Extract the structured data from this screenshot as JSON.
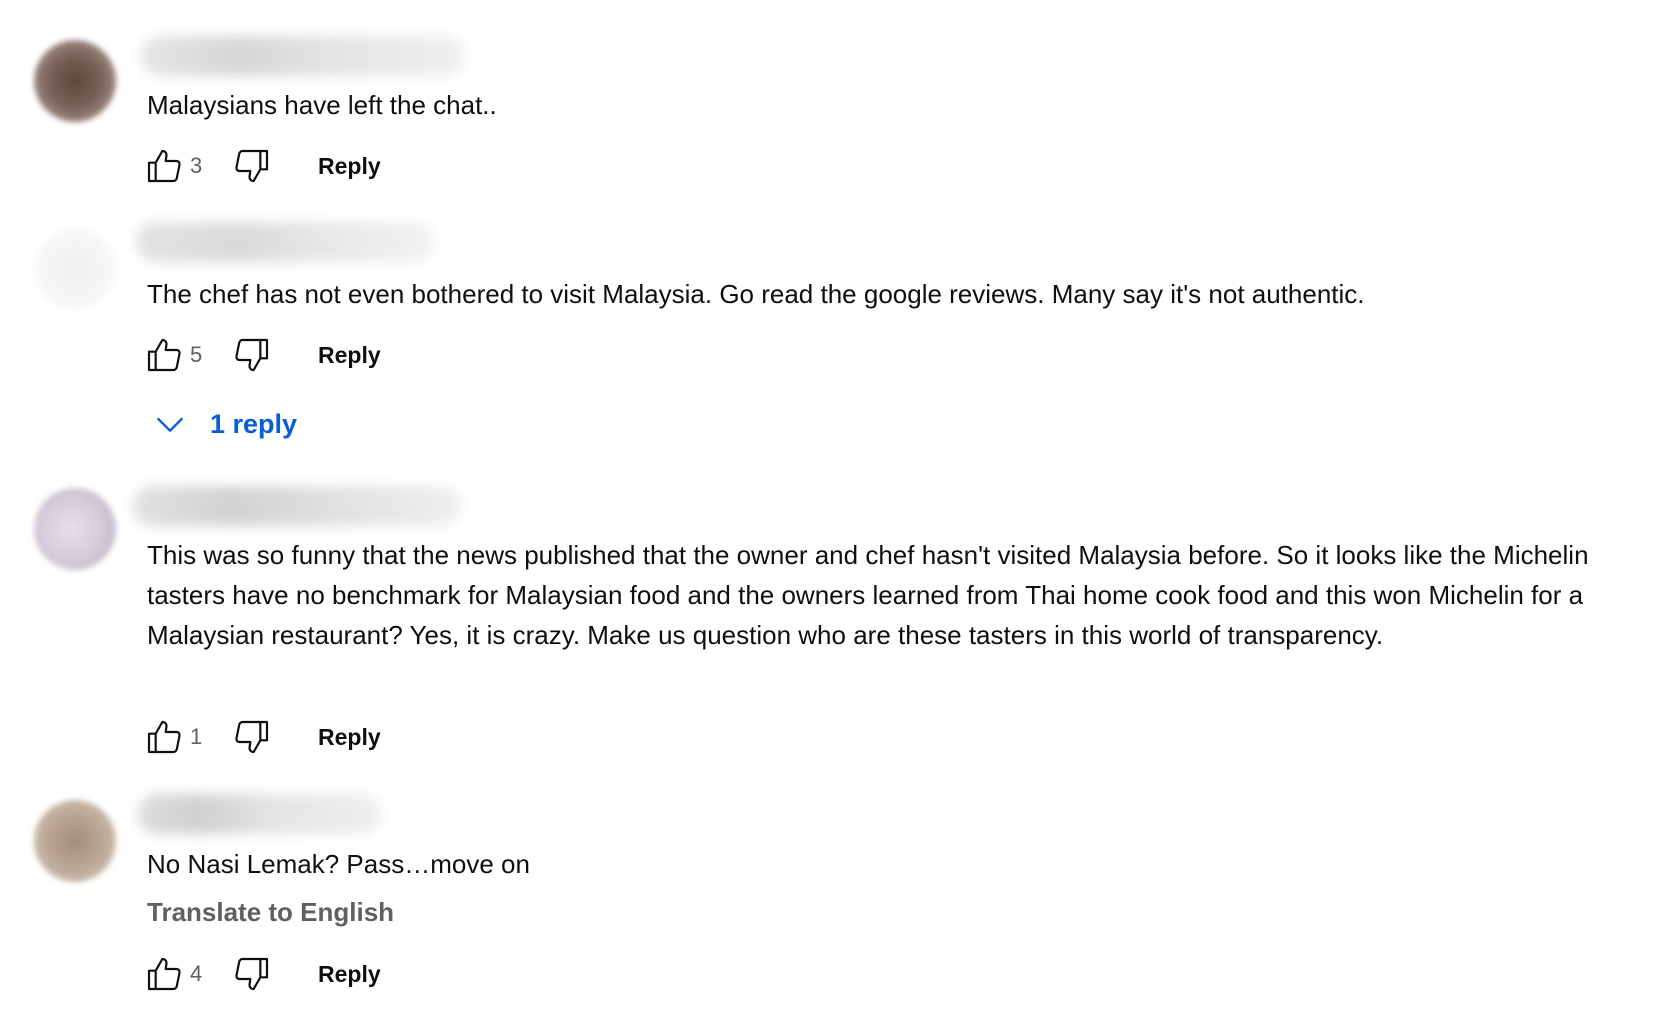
{
  "comments": [
    {
      "text": "Malaysians have left the chat..",
      "likes": "3",
      "reply_label": "Reply",
      "avatar_color": "#7a6259"
    },
    {
      "text": "The chef has not even bothered to visit Malaysia. Go read the google reviews. Many say it's not authentic.",
      "likes": "5",
      "reply_label": "Reply",
      "avatar_color": "#f4f4f4",
      "replies_label": "1 reply"
    },
    {
      "text": "This was so funny that the news published that the owner and chef hasn't visited Malaysia before. So it looks like the Michelin tasters have no benchmark for Malaysian food and the owners learned from Thai home cook food and this won Michelin for a Malaysian restaurant? Yes, it is crazy. Make us question who are these tasters in this world of transparency.",
      "likes": "1",
      "reply_label": "Reply",
      "avatar_color": "#d8d2dc"
    },
    {
      "text": "No Nasi Lemak? Pass…move on",
      "translate_label": "Translate to English",
      "likes": "4",
      "reply_label": "Reply",
      "avatar_color": "#b9a593"
    }
  ],
  "colors": {
    "text": "#0f0f0f",
    "secondary": "#606060",
    "link": "#065fd4"
  }
}
